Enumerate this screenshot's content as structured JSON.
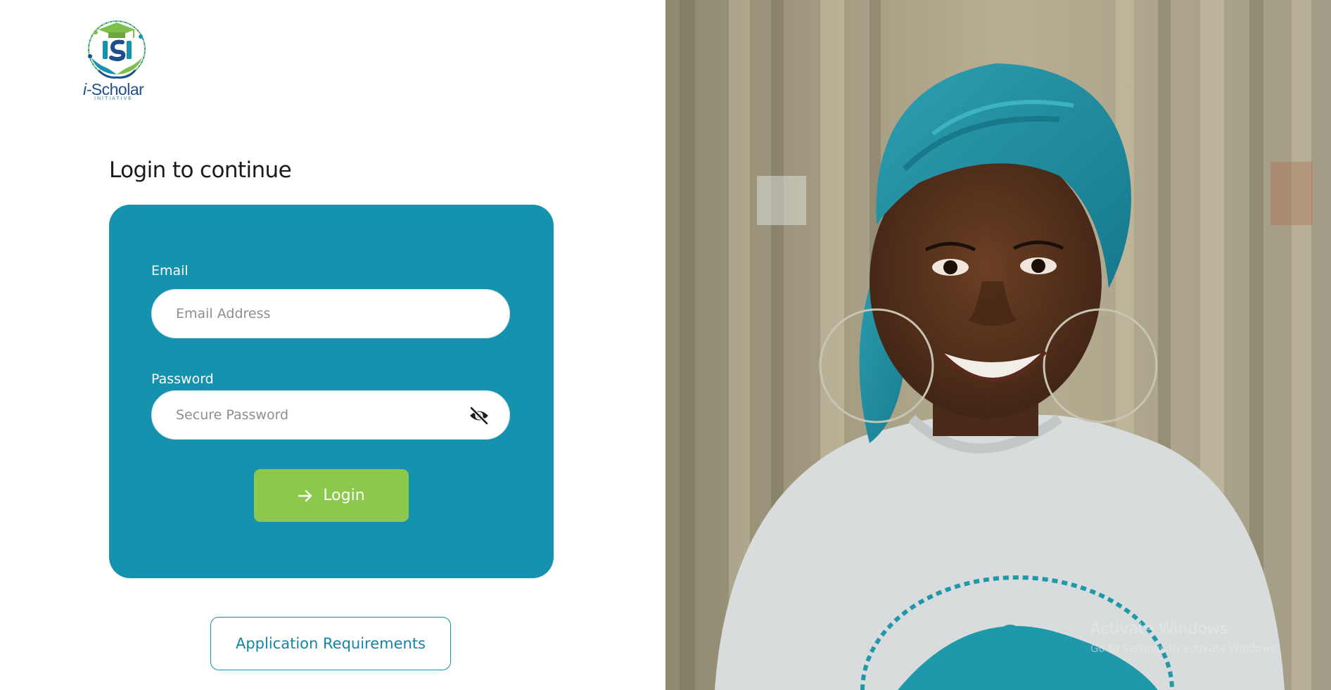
{
  "brand": {
    "logo_letters": "iSI",
    "name_prefix": "i-",
    "name_main": "Scholar",
    "tagline": "INITIATIVE"
  },
  "login": {
    "heading": "Login to continue",
    "email": {
      "label": "Email",
      "placeholder": "Email Address",
      "value": ""
    },
    "password": {
      "label": "Password",
      "placeholder": "Secure Password",
      "value": "",
      "toggle_icon": "eye-slash-icon"
    },
    "submit": {
      "label": "Login",
      "icon": "arrow-right-icon"
    }
  },
  "secondary_action": {
    "label": "Application Requirements"
  },
  "hero_image": {
    "subject": "student-photo"
  },
  "system_watermark": {
    "title": "Activate Windows",
    "subtitle": "Go to Settings to activate Windows."
  },
  "colors": {
    "card": "#1492ae",
    "login_button": "#8cc84b",
    "secondary_border": "#1492ae",
    "heading_text": "#1a1a1a"
  }
}
